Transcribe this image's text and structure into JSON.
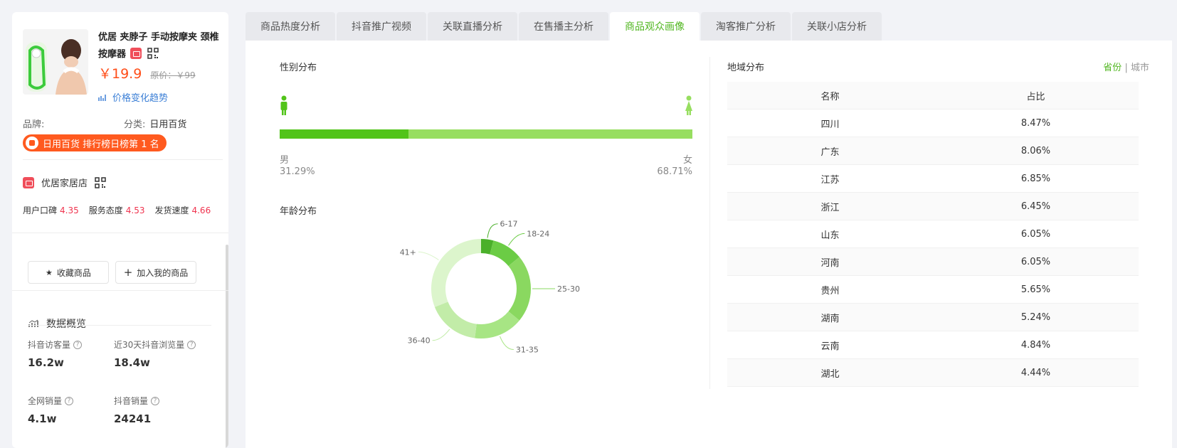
{
  "product": {
    "title": "优居 夹脖子 手动按摩夹 颈椎按摩器",
    "price": "￥19.9",
    "original_price": "原价：￥99",
    "price_trend_label": "价格变化趋势",
    "brand_label": "品牌:",
    "brand_value": "",
    "category_label": "分类:",
    "category_value": "日用百货",
    "rank_text": "日用百货 排行榜日榜第 1 名"
  },
  "shop": {
    "name": "优居家居店",
    "scores": [
      {
        "label": "用户口碑",
        "value": "4.35"
      },
      {
        "label": "服务态度",
        "value": "4.53"
      },
      {
        "label": "发货速度",
        "value": "4.66"
      }
    ]
  },
  "actions": {
    "favorite": "收藏商品",
    "add_mine": "加入我的商品"
  },
  "overview": {
    "title": "数据概览",
    "stats": [
      {
        "label": "抖音访客量",
        "value": "16.2w"
      },
      {
        "label": "近30天抖音浏览量",
        "value": "18.4w"
      },
      {
        "label": "全网销量",
        "value": "4.1w"
      },
      {
        "label": "抖音销量",
        "value": "24241"
      }
    ]
  },
  "tabs": [
    {
      "label": "商品热度分析",
      "active": false
    },
    {
      "label": "抖音推广视频",
      "active": false
    },
    {
      "label": "关联直播分析",
      "active": false
    },
    {
      "label": "在售播主分析",
      "active": false
    },
    {
      "label": "商品观众画像",
      "active": true
    },
    {
      "label": "淘客推广分析",
      "active": false
    },
    {
      "label": "关联小店分析",
      "active": false
    }
  ],
  "gender": {
    "title": "性别分布",
    "male_label": "男",
    "male_pct": "31.29%",
    "male_fraction": 0.3129,
    "female_label": "女",
    "female_pct": "68.71%"
  },
  "age": {
    "title": "年龄分布"
  },
  "region": {
    "title": "地域分布",
    "toggle_province": "省份",
    "toggle_sep": "|",
    "toggle_city": "城市",
    "col_name": "名称",
    "col_share": "占比",
    "rows": [
      {
        "name": "四川",
        "share": "8.47%"
      },
      {
        "name": "广东",
        "share": "8.06%"
      },
      {
        "name": "江苏",
        "share": "6.85%"
      },
      {
        "name": "浙江",
        "share": "6.45%"
      },
      {
        "name": "山东",
        "share": "6.05%"
      },
      {
        "name": "河南",
        "share": "6.05%"
      },
      {
        "name": "贵州",
        "share": "5.65%"
      },
      {
        "name": "湖南",
        "share": "5.24%"
      },
      {
        "name": "云南",
        "share": "4.84%"
      },
      {
        "name": "湖北",
        "share": "4.44%"
      }
    ]
  },
  "colors": {
    "accent": "#52b722",
    "male": "#52c41a",
    "female": "#97de60",
    "price": "#ff4d18",
    "score": "#f0344f"
  },
  "chart_data": {
    "type": "pie",
    "donut": true,
    "categories": [
      "6-17",
      "18-24",
      "25-30",
      "31-35",
      "36-40",
      "41+"
    ],
    "values": [
      4,
      10,
      22,
      16,
      17,
      31
    ],
    "colors": [
      "#4bb02a",
      "#6bcc45",
      "#8ad860",
      "#a7e584",
      "#c2eca8",
      "#dcf5cc"
    ]
  }
}
